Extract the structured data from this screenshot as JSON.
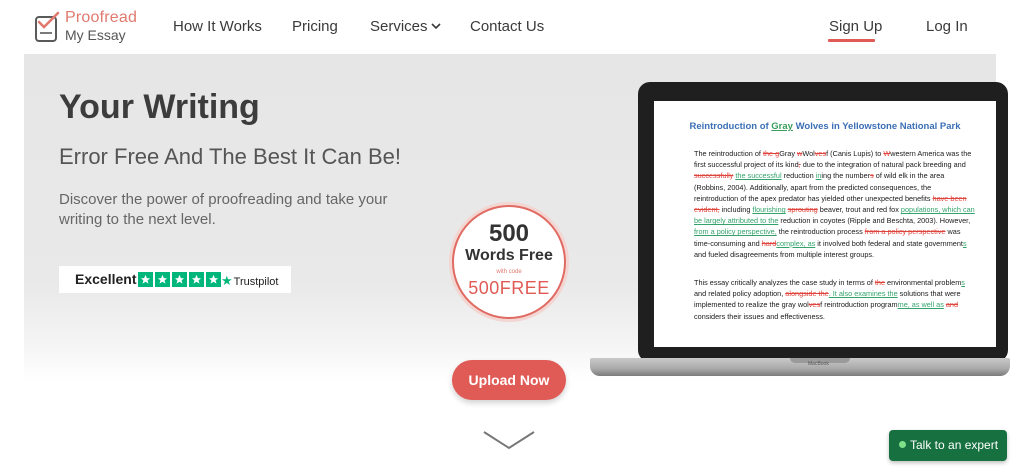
{
  "logo": {
    "line1": "Proofread",
    "line2": "My Essay"
  },
  "nav": {
    "how_it_works": "How It Works",
    "pricing": "Pricing",
    "services": "Services",
    "contact": "Contact Us",
    "sign_up": "Sign Up",
    "log_in": "Log In"
  },
  "hero": {
    "title": "Your Writing",
    "subtitle": "Error Free And The Best It Can Be!",
    "description": "Discover the power of proofreading and take your writing to the next level."
  },
  "trustpilot": {
    "rating_label": "Excellent",
    "stars": 5,
    "brand": "Trustpilot"
  },
  "badge": {
    "number": "500",
    "words": "Words Free",
    "code_label": "with code",
    "code": "500FREE"
  },
  "upload_button": "Upload Now",
  "laptop_brand": "MacBook",
  "document": {
    "title_before": "Reintroduction of ",
    "title_highlight": "Gray",
    "title_after": " Wolves in Yellowstone National Park"
  },
  "chat": {
    "label": "Talk to an expert"
  },
  "colors": {
    "accent": "#e05b56",
    "trustpilot_green": "#00b67a",
    "chat_green": "#16703f",
    "doc_title_blue": "#3b6fb5"
  }
}
